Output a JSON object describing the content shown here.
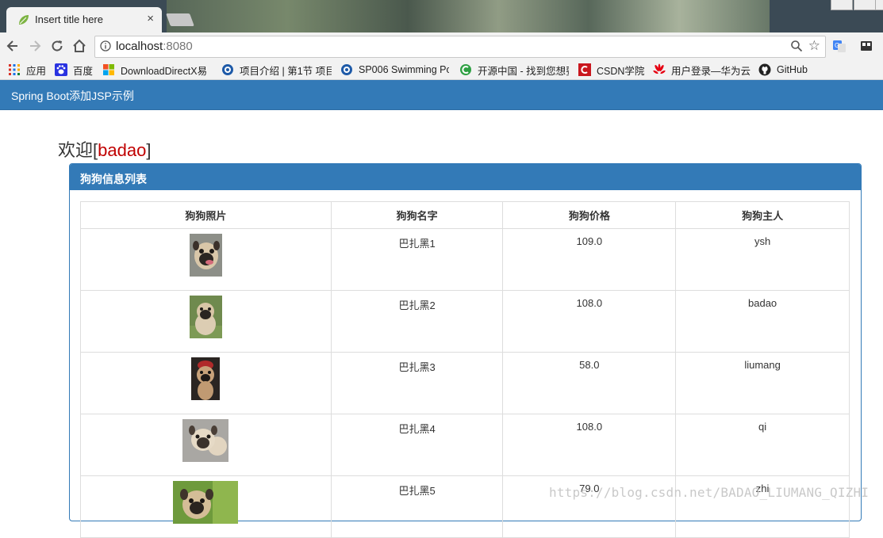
{
  "browser": {
    "tab_title": "Insert title here",
    "tab_close": "×",
    "url_host": "localhost",
    "url_port": ":8080",
    "bookmarks": [
      {
        "label": "应用",
        "icon": "apps-grid-icon"
      },
      {
        "label": "百度",
        "icon": "baidu-paw-icon"
      },
      {
        "label": "DownloadDirectX易",
        "icon": "windows-logo-icon"
      },
      {
        "label": "项目介绍 | 第1节 项目",
        "icon": "circle-logo-icon"
      },
      {
        "label": "SP006 Swimming Po",
        "icon": "circle-logo-icon"
      },
      {
        "label": "开源中国 - 找到您想要",
        "icon": "oschina-icon"
      },
      {
        "label": "CSDN学院",
        "icon": "csdn-icon"
      },
      {
        "label": "用户登录—华为云",
        "icon": "huawei-icon"
      },
      {
        "label": "GitHub",
        "icon": "github-icon"
      }
    ]
  },
  "page": {
    "brand": "Spring Boot添加JSP示例",
    "welcome_prefix": "欢迎[",
    "welcome_user": "badao",
    "welcome_suffix": "]",
    "panel_title": "狗狗信息列表",
    "columns": [
      "狗狗照片",
      "狗狗名字",
      "狗狗价格",
      "狗狗主人"
    ],
    "rows": [
      {
        "name": "巴扎黑1",
        "price": "109.0",
        "owner": "ysh"
      },
      {
        "name": "巴扎黑2",
        "price": "108.0",
        "owner": "badao"
      },
      {
        "name": "巴扎黑3",
        "price": "58.0",
        "owner": "liumang"
      },
      {
        "name": "巴扎黑4",
        "price": "108.0",
        "owner": "qi"
      },
      {
        "name": "巴扎黑5",
        "price": "79.0",
        "owner": "zhi"
      }
    ],
    "watermark": "https://blog.csdn.net/BADAO_LIUMANG_QIZHI"
  },
  "colors": {
    "primary": "#337ab7",
    "welcome_user": "#c00000"
  }
}
